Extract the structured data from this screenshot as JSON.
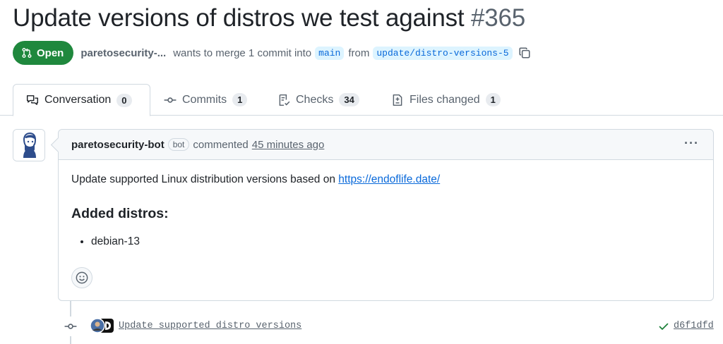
{
  "pr": {
    "title": "Update versions of distros we test against",
    "number": "#365",
    "state": "Open",
    "author": "paretosecurity-...",
    "merge_text": "wants to merge 1 commit into",
    "base_branch": "main",
    "from_text": "from",
    "head_branch": "update/distro-versions-5"
  },
  "tabs": [
    {
      "label": "Conversation",
      "count": "0",
      "icon": "comment-discussion-icon"
    },
    {
      "label": "Commits",
      "count": "1",
      "icon": "git-commit-icon"
    },
    {
      "label": "Checks",
      "count": "34",
      "icon": "checklist-icon"
    },
    {
      "label": "Files changed",
      "count": "1",
      "icon": "file-diff-icon"
    }
  ],
  "comment": {
    "author": "paretosecurity-bot",
    "badge": "bot",
    "verb": "commented",
    "time": "45 minutes ago",
    "menu": "···",
    "body_text": "Update supported Linux distribution versions based on",
    "body_link": "https://endoflife.date/",
    "heading": "Added distros:",
    "items": [
      "debian-13"
    ]
  },
  "commit": {
    "message": "Update supported distro versions",
    "sha": "d6f1dfd",
    "status": "success"
  },
  "colors": {
    "open_green": "#1f883d",
    "link_blue": "#0969da",
    "branch_bg": "#ddf4ff",
    "border": "#d1d9e0",
    "muted": "#59636e"
  }
}
